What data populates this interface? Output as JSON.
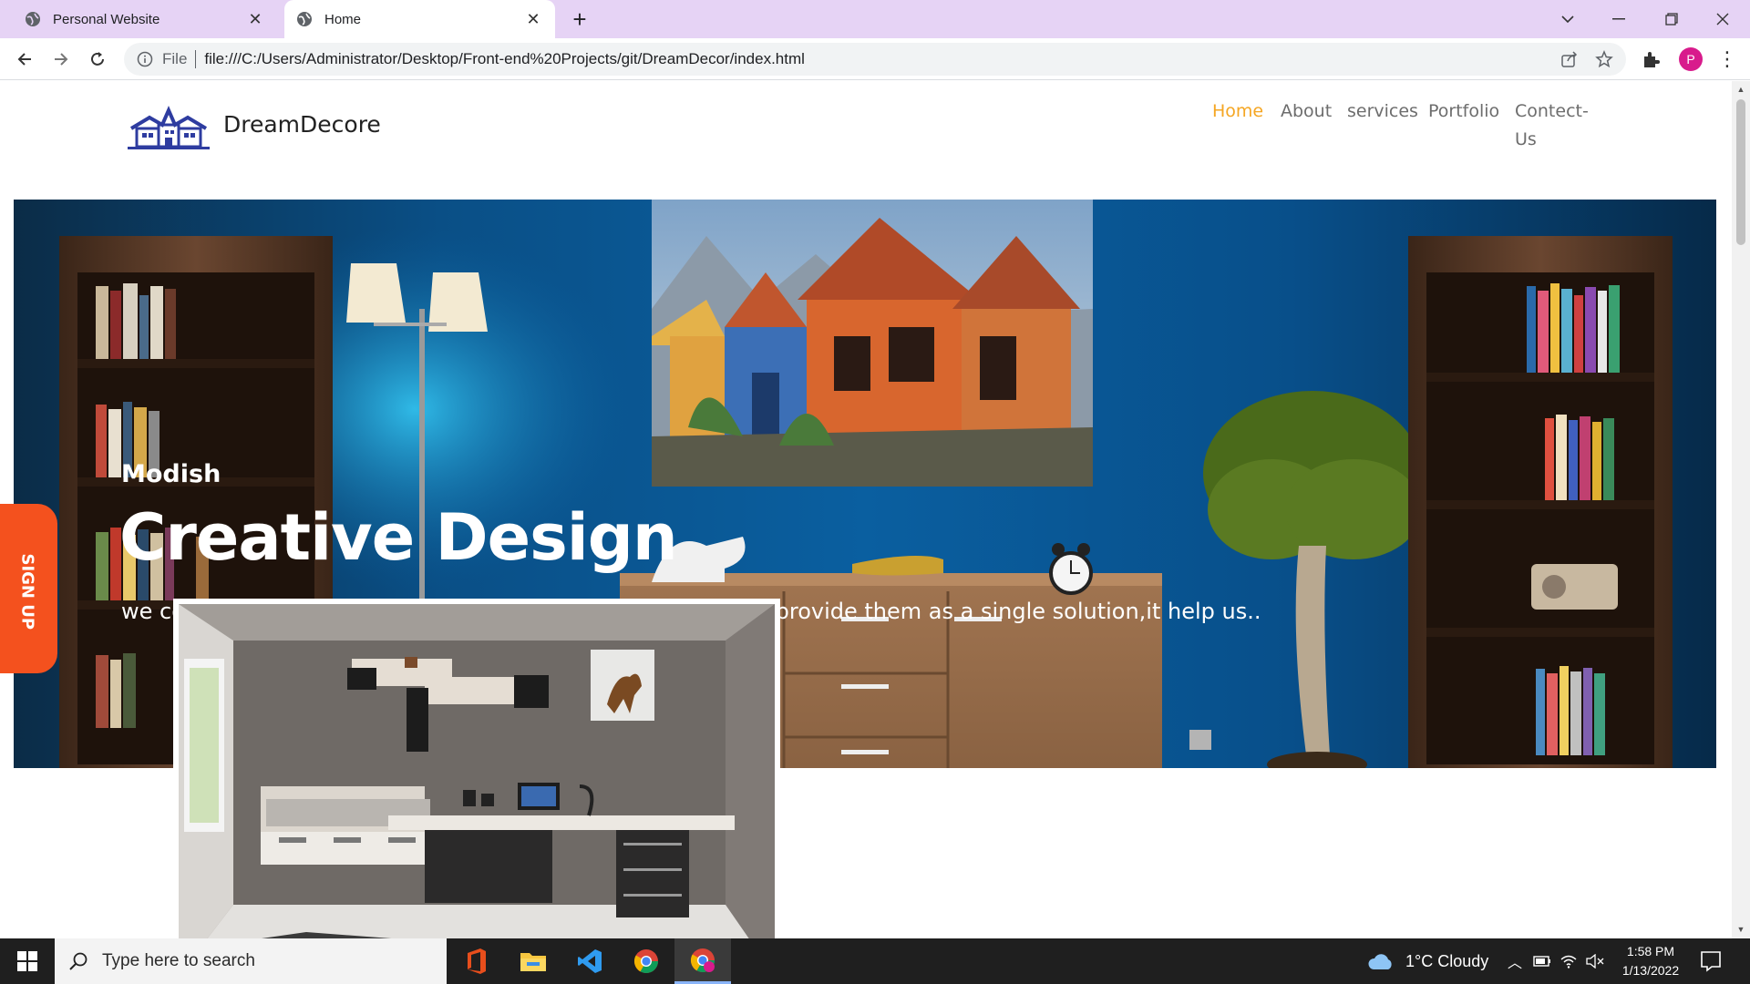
{
  "browser": {
    "tabs": [
      {
        "title": "Personal Website"
      },
      {
        "title": "Home"
      }
    ],
    "address": {
      "scheme": "File",
      "url": "file:///C:/Users/Administrator/Desktop/Front-end%20Projects/git/DreamDecor/index.html"
    },
    "profile_initial": "P"
  },
  "site": {
    "brand": "DreamDecore",
    "nav": {
      "home": "Home",
      "about": "About",
      "services": "services",
      "portfolio": "Portfolio",
      "contact_line1": "Contect-",
      "contact_line2": "Us"
    },
    "hero": {
      "kicker": "Modish",
      "title": "Creative Design",
      "subtitle": "we combine interior and exterior design services and often provide them as a single solution,it help us.."
    },
    "signup_label": "SIGN UP",
    "accent_color": "#f5a623",
    "signup_color": "#f4511e"
  },
  "taskbar": {
    "search_placeholder": "Type here to search",
    "weather": "1°C  Cloudy",
    "time": "1:58 PM",
    "date": "1/13/2022"
  }
}
